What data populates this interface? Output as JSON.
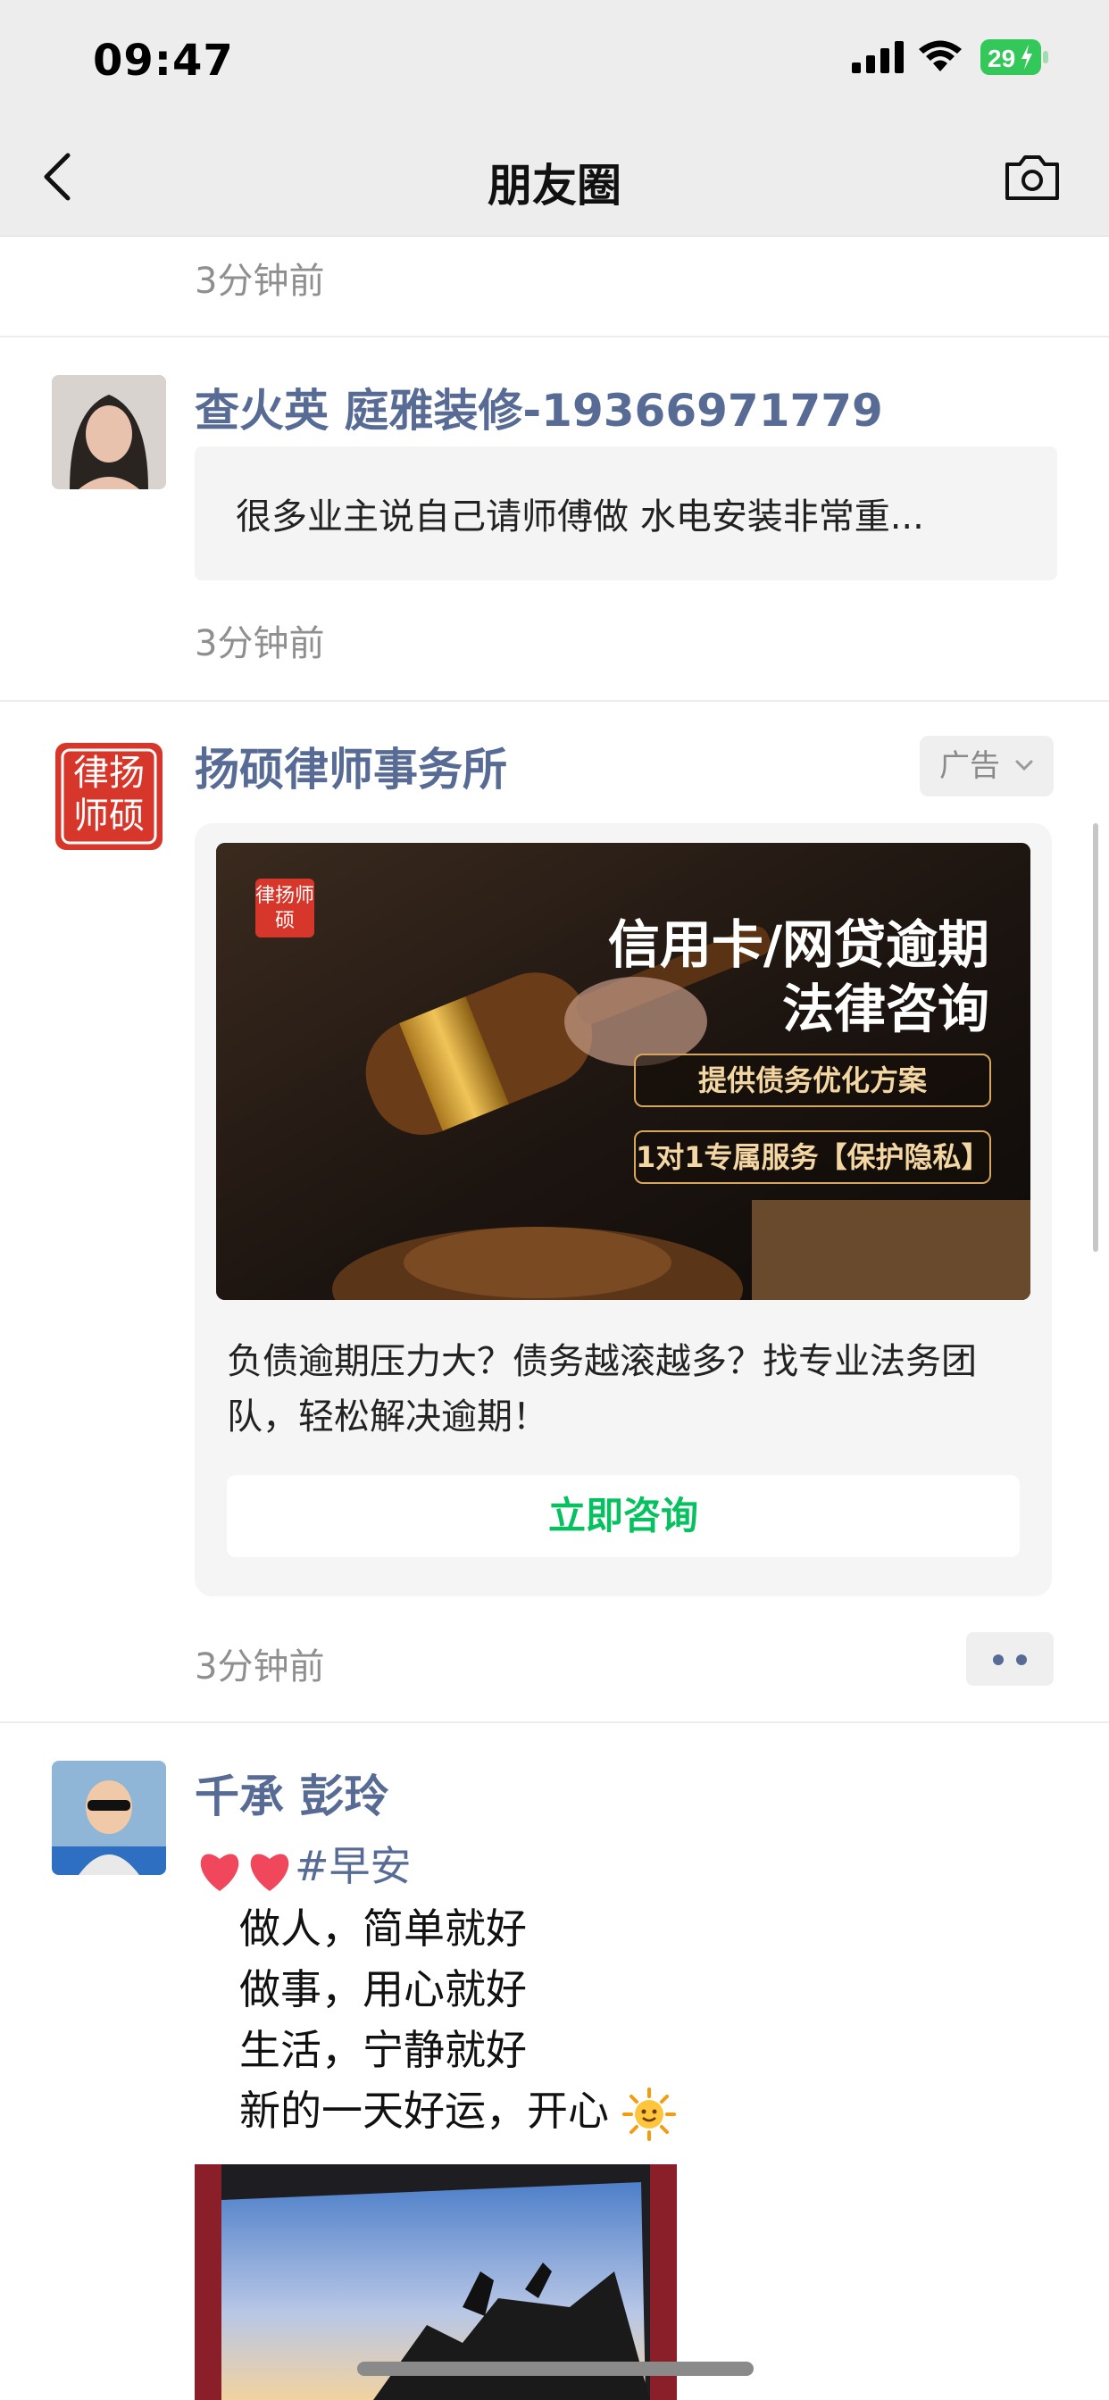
{
  "status_bar": {
    "time": "09:47",
    "battery": "29"
  },
  "nav": {
    "title": "朋友圈"
  },
  "feed": {
    "top_timestamp": "3分钟前",
    "posts": [
      {
        "nickname": "查火英 庭雅装修-19366971779",
        "share_text": "很多业主说自己请师傅做  水电安装非常重...",
        "timestamp": "3分钟前"
      },
      {
        "nickname": "扬硕律师事务所",
        "ad_label": "广告",
        "avatar_text": "律扬师硕",
        "ad_image": {
          "logo_text": "律扬师硕",
          "headline_1": "信用卡/网贷逾期",
          "headline_2": "法律咨询",
          "pill_1": "提供债务优化方案",
          "pill_2": "1对1专属服务【保护隐私】"
        },
        "description": "负债逾期压力大？债务越滚越多？找专业法务团队，轻松解决逾期！",
        "button_label": "立即咨询",
        "timestamp": "3分钟前"
      },
      {
        "nickname": "千承  彭玲",
        "hashtag_line": "#早安",
        "lines": [
          "做人，简单就好",
          "做事，用心就好",
          "生活，宁静就好",
          "新的一天好运，开心"
        ]
      }
    ]
  }
}
